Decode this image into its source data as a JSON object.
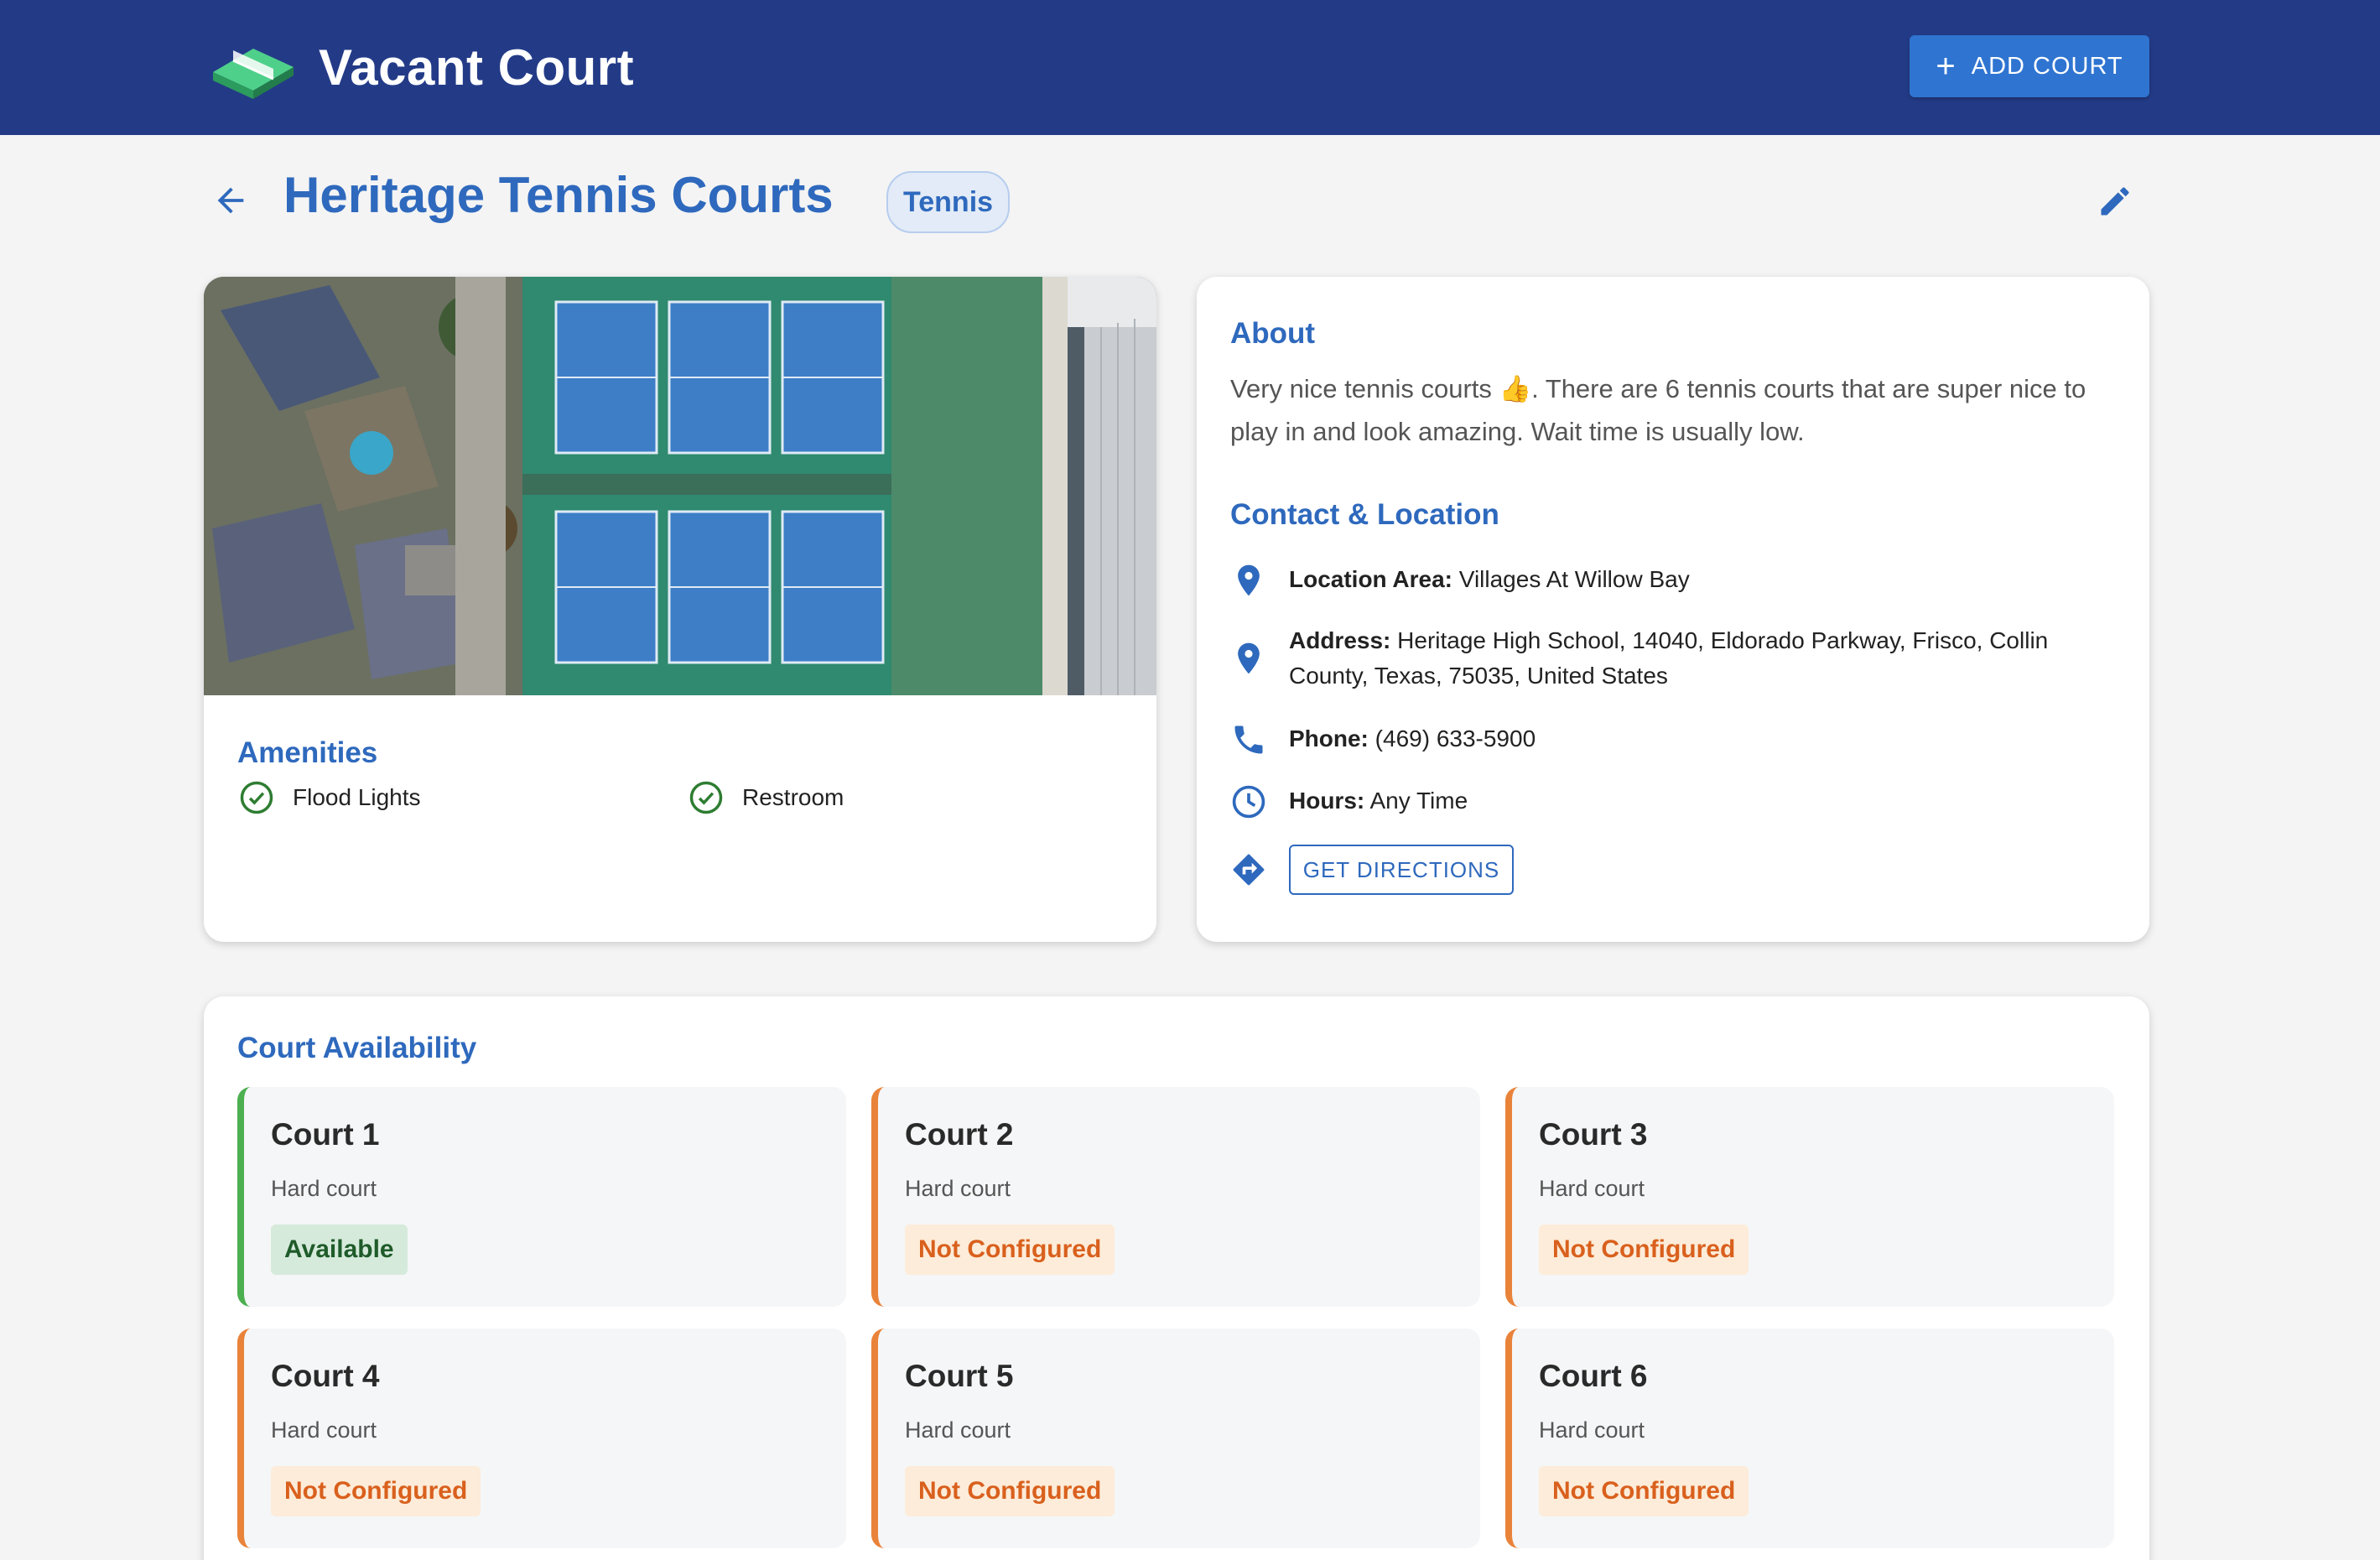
{
  "header": {
    "app_name": "Vacant Court",
    "add_court_label": "ADD COURT"
  },
  "page": {
    "title": "Heritage Tennis Courts",
    "sport": "Tennis"
  },
  "amenities": {
    "heading": "Amenities",
    "items": [
      "Flood Lights",
      "Restroom"
    ]
  },
  "about": {
    "heading": "About",
    "text": "Very nice tennis courts 👍. There are 6 tennis courts that are super nice to play in and look amazing. Wait time is usually low."
  },
  "contact": {
    "heading": "Contact & Location",
    "location_label": "Location Area:",
    "location_value": "Villages At Willow Bay",
    "address_label": "Address:",
    "address_value": "Heritage High School, 14040, Eldorado Parkway, Frisco, Collin County, Texas, 75035, United States",
    "phone_label": "Phone:",
    "phone_value": "(469) 633-5900",
    "hours_label": "Hours:",
    "hours_value": "Any Time",
    "directions_label": "GET DIRECTIONS"
  },
  "availability": {
    "heading": "Court Availability",
    "courts": [
      {
        "name": "Court 1",
        "surface": "Hard court",
        "status": "Available"
      },
      {
        "name": "Court 2",
        "surface": "Hard court",
        "status": "Not Configured"
      },
      {
        "name": "Court 3",
        "surface": "Hard court",
        "status": "Not Configured"
      },
      {
        "name": "Court 4",
        "surface": "Hard court",
        "status": "Not Configured"
      },
      {
        "name": "Court 5",
        "surface": "Hard court",
        "status": "Not Configured"
      },
      {
        "name": "Court 6",
        "surface": "Hard court",
        "status": "Not Configured"
      }
    ]
  },
  "colors": {
    "header_bg": "#233b87",
    "accent": "#2e69bd",
    "available": "#4caf50",
    "not_configured": "#e9833a"
  }
}
